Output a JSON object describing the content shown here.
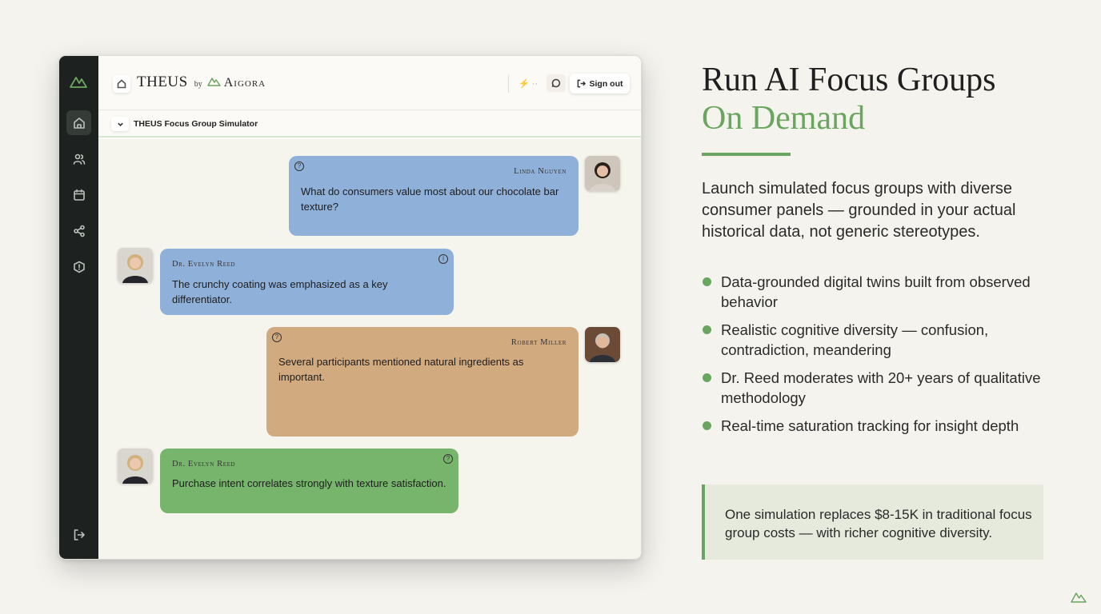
{
  "app": {
    "brand_theus": "THEUS",
    "brand_by": "by",
    "brand_aigora": "Aigora",
    "sign_out": "Sign out",
    "misc_label": "⚡ ··",
    "subbar_title": "THEUS Focus Group Simulator"
  },
  "sidebar": {
    "items": [
      {
        "icon": "home-icon",
        "active": true
      },
      {
        "icon": "users-icon"
      },
      {
        "icon": "calendar-icon"
      },
      {
        "icon": "share-icon"
      },
      {
        "icon": "shield-icon"
      }
    ],
    "bottom": {
      "icon": "logout-icon"
    }
  },
  "messages": [
    {
      "speaker": "Linda Nguyen",
      "text": "What do consumers value most about our chocolate bar texture?",
      "color": "#8fb0d9",
      "side": "right"
    },
    {
      "speaker": "Dr. Evelyn Reed",
      "text": "The crunchy coating was emphasized as a key differentiator.",
      "color": "#8fb0d9",
      "side": "left"
    },
    {
      "speaker": "Robert Miller",
      "text": "Several participants mentioned natural ingredients as important.",
      "color": "#d1aa80",
      "side": "right"
    },
    {
      "speaker": "Dr. Evelyn Reed",
      "text": "Purchase intent correlates strongly with texture satisfaction.",
      "color": "#76b56b",
      "side": "left"
    }
  ],
  "marketing": {
    "headline_line1": "Run AI Focus Groups",
    "headline_line2": "On Demand",
    "lead": "Launch simulated focus groups with diverse consumer panels — grounded in your actual historical data, not generic stereotypes.",
    "bullets": [
      "Data-grounded digital twins built from observed behavior",
      "Realistic cognitive diversity — confusion, contradiction, meandering",
      "Dr. Reed moderates with 20+ years of qualitative methodology",
      "Real-time saturation tracking for insight depth"
    ],
    "callout": "One simulation replaces $8-15K in traditional focus group costs — with richer cognitive diversity.",
    "accent_color": "#6aa65f"
  }
}
